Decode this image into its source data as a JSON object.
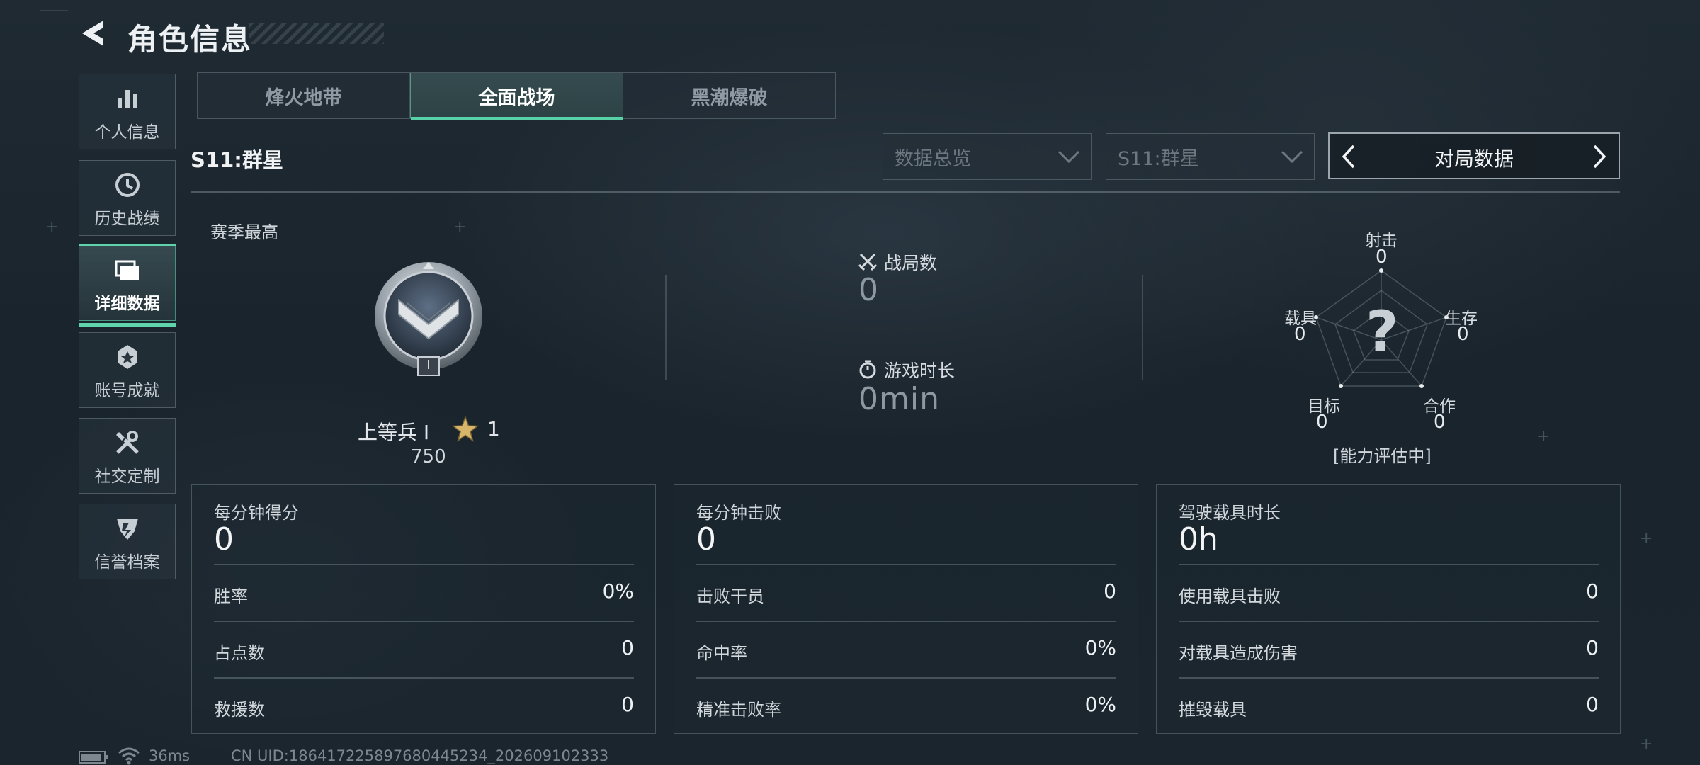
{
  "header": {
    "title": "角色信息"
  },
  "sidebar": {
    "items": [
      {
        "label": "个人信息",
        "icon": "bar-chart-icon"
      },
      {
        "label": "历史战绩",
        "icon": "history-icon"
      },
      {
        "label": "详细数据",
        "icon": "detail-data-icon",
        "active": true
      },
      {
        "label": "账号成就",
        "icon": "achievement-icon"
      },
      {
        "label": "社交定制",
        "icon": "tools-icon"
      },
      {
        "label": "信誉档案",
        "icon": "credit-shield-icon"
      }
    ]
  },
  "tabs": [
    {
      "label": "烽火地带"
    },
    {
      "label": "全面战场",
      "active": true
    },
    {
      "label": "黑潮爆破"
    }
  ],
  "season": {
    "label": "S11:群星"
  },
  "filters": {
    "overview": "数据总览",
    "season": "S11:群星",
    "match_selector": "对局数据"
  },
  "season_best": {
    "label": "赛季最高",
    "rank_name": "上等兵 I",
    "stars": "1",
    "points": "750",
    "badge_numeral": "I"
  },
  "match_stats": {
    "matches_label": "战局数",
    "matches_value": "0",
    "playtime_label": "游戏时长",
    "playtime_value": "0min"
  },
  "radar": {
    "shooting_label": "射击",
    "shooting_value": "0",
    "survival_label": "生存",
    "survival_value": "0",
    "cooperation_label": "合作",
    "cooperation_value": "0",
    "objective_label": "目标",
    "objective_value": "0",
    "vehicle_label": "载具",
    "vehicle_value": "0",
    "center_mark": "?",
    "status": "[能力评估中]"
  },
  "cards": [
    {
      "header_label": "每分钟得分",
      "header_value": "0",
      "rows": [
        {
          "label": "胜率",
          "value": "0%"
        },
        {
          "label": "占点数",
          "value": "0"
        },
        {
          "label": "救援数",
          "value": "0"
        }
      ]
    },
    {
      "header_label": "每分钟击败",
      "header_value": "0",
      "rows": [
        {
          "label": "击败干员",
          "value": "0"
        },
        {
          "label": "命中率",
          "value": "0%"
        },
        {
          "label": "精准击败率",
          "value": "0%"
        }
      ]
    },
    {
      "header_label": "驾驶载具时长",
      "header_value": "0h",
      "rows": [
        {
          "label": "使用载具击败",
          "value": "0"
        },
        {
          "label": "对载具造成伤害",
          "value": "0"
        },
        {
          "label": "摧毁载具",
          "value": "0"
        }
      ]
    }
  ],
  "footer": {
    "ping": "36ms",
    "uid": "CN UID:18641722589768044523​4_202609102333"
  },
  "colors": {
    "accent": "#56d2a6",
    "text": "#d8dde2",
    "muted": "#8d98a2"
  }
}
